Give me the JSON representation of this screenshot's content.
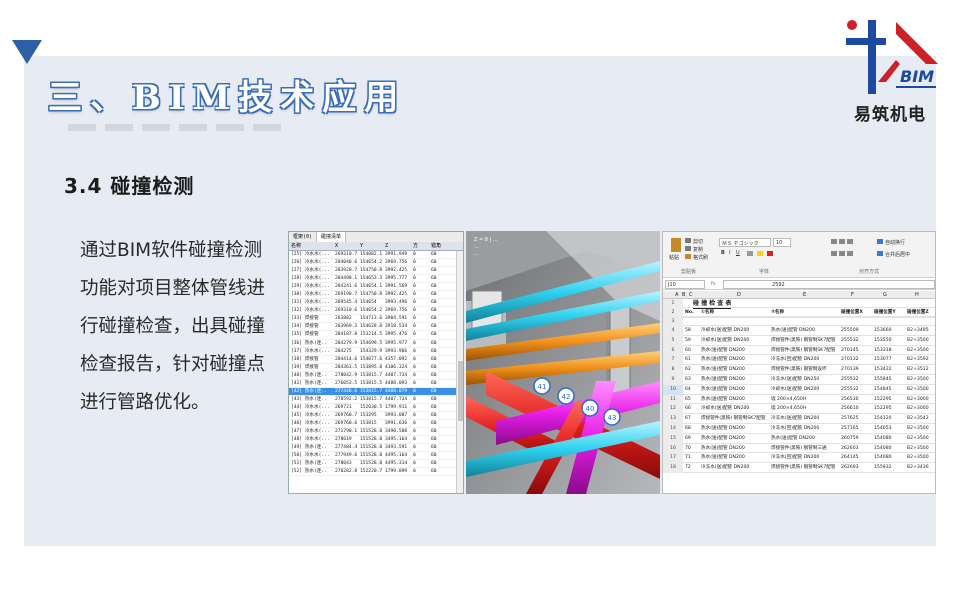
{
  "header": {
    "title": "三、BIM技术应用",
    "logo_text": "易筑机电",
    "logo_mark": "BIM",
    "colors": {
      "accent": "#2f5fa6",
      "logo_red": "#cc2128",
      "logo_blue": "#1b4aa0"
    }
  },
  "section": {
    "heading": "3.4 碰撞检测",
    "body": "通过BIM软件碰撞检测功能对项目整体管线进行碰撞检查，出具碰撞检查报告，针对碰撞点进行管路优化。"
  },
  "clash_list": {
    "tabs": [
      "框架(0)",
      "碰撞清单"
    ],
    "columns": [
      "名称",
      "X",
      "Y",
      "Z",
      "方",
      "错角"
    ],
    "rows": [
      [
        "[25] 冷水水(...",
        "269310.7",
        "154082.1",
        "3991.949",
        "0",
        "60"
      ],
      [
        "[26] 冷水水(...",
        "284040.6",
        "154654.2",
        "3969.756",
        "0",
        "60"
      ],
      [
        "[27] 冷水水(...",
        "283920.7",
        "154750.8",
        "3992.425",
        "0",
        "60"
      ],
      [
        "[28] 冷水水(...",
        "284490.1",
        "154653.3",
        "3995.777",
        "0",
        "60"
      ],
      [
        "[29] 冷水水(...",
        "284241.6",
        "154654.1",
        "3991.569",
        "0",
        "60"
      ],
      [
        "[30] 冷水水(...",
        "269190.7",
        "154750.8",
        "3992.425",
        "0",
        "60"
      ],
      [
        "[31] 冷水水(...",
        "269545.4",
        "154654",
        "3993.496",
        "0",
        "60"
      ],
      [
        "[32] 冷水水(...",
        "269310.6",
        "154654.2",
        "3969.756",
        "0",
        "60"
      ],
      [
        "[33] 焊接管",
        "263882",
        "154713.6",
        "3904.591",
        "0",
        "60"
      ],
      [
        "[34] 焊接管",
        "263969.3",
        "154628.8",
        "3918.534",
        "0",
        "60"
      ],
      [
        "[35] 焊接管",
        "284187.8",
        "153214.5",
        "3995.476",
        "0",
        "60"
      ],
      [
        "[36] 热水(连..",
        "284279.9",
        "154699.5",
        "3995.977",
        "0",
        "60"
      ],
      [
        "[37] 冷水水(...",
        "284275",
        "154329.9",
        "3993.966",
        "0",
        "60"
      ],
      [
        "[38] 焊接管",
        "284414.6",
        "154077.6",
        "4357.092",
        "0",
        "60"
      ],
      [
        "[39] 焊接管",
        "284363.5",
        "153895.8",
        "4106.324",
        "0",
        "60"
      ],
      [
        "[40] 热水(连..",
        "278042.9",
        "153815.7",
        "4407.734",
        "0",
        "60"
      ],
      [
        "[41] 热水(连..",
        "276053.5",
        "153815.5",
        "4488.093",
        "0",
        "60"
      ],
      [
        "[42] 热水(连..",
        "277448.6",
        "153815.7",
        "4488.079",
        "0",
        "60"
      ],
      [
        "[43] 热水(连..",
        "278592.2",
        "153815.7",
        "4407.734",
        "0",
        "60"
      ],
      [
        "[44] 冷水水(...",
        "269721",
        "152030.5",
        "1799.911",
        "0",
        "60"
      ],
      [
        "[45] 冷水水(...",
        "269760.7",
        "153295",
        "3993.087",
        "0",
        "60"
      ],
      [
        "[46] 冷水水(...",
        "269760.6",
        "153815",
        "3991.636",
        "0",
        "60"
      ],
      [
        "[47] 冷水水(...",
        "271790.1",
        "151528.8",
        "3490.508",
        "0",
        "60"
      ],
      [
        "[48] 冷水水(...",
        "278619",
        "151528.8",
        "3495.164",
        "0",
        "60"
      ],
      [
        "[49] 热水(连..",
        "277484.4",
        "151528.8",
        "3493.591",
        "0",
        "60"
      ],
      [
        "[50] 冷水水(...",
        "277949.6",
        "151528.8",
        "4495.164",
        "0",
        "60"
      ],
      [
        "[51] 热水(连..",
        "278043",
        "151528.8",
        "4495.314",
        "0",
        "60"
      ],
      [
        "[52] 热水(连..",
        "278282.8",
        "152220.7",
        "1799.899",
        "0",
        "60"
      ]
    ],
    "selected_index": 17
  },
  "viewport": {
    "overlay_line1": "Z = 8 | ...",
    "overlay_line2": "...",
    "overlay_line3": "...",
    "markers": [
      "41",
      "42",
      "40",
      "43"
    ],
    "colors": {
      "red": "#e01e1e",
      "magenta": "#e81ee8",
      "cyan": "#2fd2ef",
      "orange": "#f0901a"
    }
  },
  "excel": {
    "ribbon": {
      "paste": "粘贴",
      "cut": "剪切",
      "copy": "复制",
      "format_painter": "格式刷",
      "clipboard_label": "剪贴板",
      "font_name": "ＭＳ Ｐゴシック",
      "font_size": "10",
      "font_label": "字体",
      "wrap_text": "自动换行",
      "merge_center": "合并后居中",
      "alignment_label": "对齐方式"
    },
    "name_box": "J10",
    "formula_value": "2592",
    "column_headers": [
      "A",
      "B",
      "C",
      "D",
      "E",
      "F",
      "G",
      "H"
    ],
    "report_title": "碰 撞 检 查 表",
    "table_headers": [
      "No.",
      "①名称",
      "②名称",
      "碰撞位置X",
      "碰撞位置Y",
      "碰撞位置Z"
    ],
    "rows": [
      [
        "58",
        "冷却水(送)配管 DN200",
        "热水(送)配管 DN200",
        "255509",
        "153660",
        "B2+3495"
      ],
      [
        "59",
        "冷却水(送)配管 DN200",
        "焊接管件(黑铁) 钢管制SK7配管",
        "255532",
        "153550",
        "B2+3500"
      ],
      [
        "60",
        "热水(送)配管 DN200",
        "焊接管件(黑铁) 钢管制SK7配管",
        "270145",
        "153318",
        "B2+3500"
      ],
      [
        "61",
        "热水(送)配管 DN200",
        "冷冻水(回)配管 DN200",
        "270132",
        "153077",
        "B2+3592"
      ],
      [
        "62",
        "热水(送)配管 DN200",
        "焊接管件(黑铁) 钢管制设坏",
        "270139",
        "153422",
        "B2+3512"
      ],
      [
        "63",
        "热水(送)配管 DN200",
        "冷冻水(送)配管 DN250",
        "255532",
        "155845",
        "B2+3500"
      ],
      [
        "64",
        "热水(送)配管 DN200",
        "冷却水(送)配管 DN200",
        "255532",
        "154845",
        "B2+3500"
      ],
      [
        "65",
        "热水(送)配管 DN200",
        "墙 200×4,650H",
        "256530",
        "152295",
        "B2+3000"
      ],
      [
        "66",
        "冷却水(送)配管 DN200",
        "墙 200×4,650H",
        "256610",
        "152295",
        "B2+3000"
      ],
      [
        "67",
        "焊接管件(黑铁) 钢管制SK7配管",
        "冷冻水(送)配管 DN200",
        "257625",
        "154120",
        "B2+3542"
      ],
      [
        "68",
        "热水(送)配管 DN200",
        "冷冻水(回)配管 DN200",
        "257165",
        "154053",
        "B2+3500"
      ],
      [
        "69",
        "热水(送)配管 DN200",
        "热水(送)配管 DN200",
        "260759",
        "154080",
        "B2+3500"
      ],
      [
        "70",
        "热水(送)配管 DN200",
        "焊接管件(黑铁) 钢管制三通",
        "262603",
        "154080",
        "B2+3500"
      ],
      [
        "71",
        "热水(送)配管 DN200",
        "冷冻水(回)配管 DN200",
        "264145",
        "154080",
        "B2+3500"
      ],
      [
        "72",
        "冷冻水(送)配管 DN200",
        "焊接管件(黑铁) 钢管制SK7配管",
        "262693",
        "155932",
        "B2+3436"
      ]
    ]
  }
}
